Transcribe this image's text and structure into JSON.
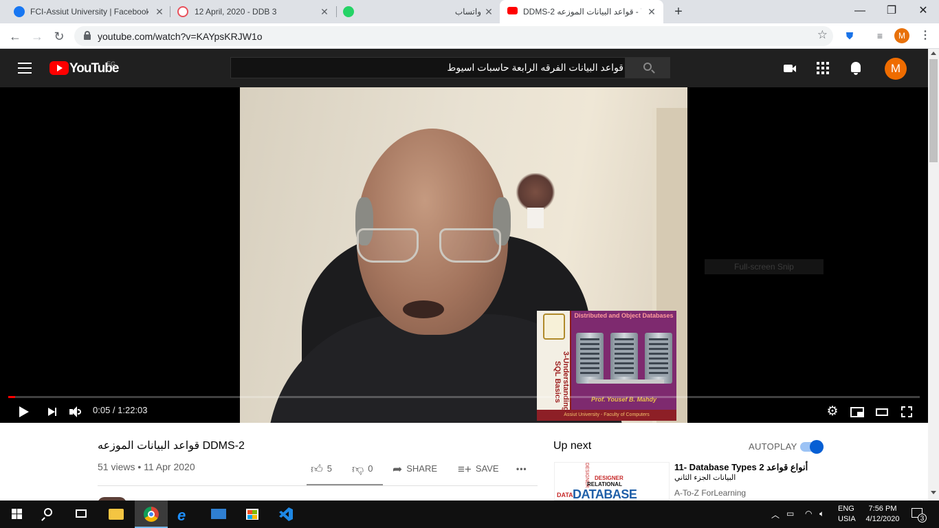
{
  "browser": {
    "tabs": [
      {
        "label": "FCI-Assiut University | Facebook",
        "icon": "facebook-icon",
        "color": "#1877f2"
      },
      {
        "label": "12 April, 2020 - DDB 3",
        "icon": "spiral-icon",
        "color": "#e8505b"
      },
      {
        "label": "واتساب",
        "icon": "whatsapp-icon",
        "color": "#25d366"
      },
      {
        "label": "DDMS-2 قواعد البيانات الموزعه - Y",
        "icon": "youtube-icon",
        "color": "#ff0000",
        "active": true
      }
    ],
    "url": "youtube.com/watch?v=KAYpsKRJW1o",
    "profile_initial": "M"
  },
  "youtube": {
    "logo_text": "YouTube",
    "country_code": "EG",
    "search_query": "قواعد البيانات الفرقه الرابعة حاسبات اسيوط",
    "avatar_initial": "M",
    "brand_color": "#ff0000"
  },
  "player": {
    "time": "0:05 / 1:22:03",
    "progress": 0.001,
    "overlay_tip": "Full-screen Snip",
    "slide": {
      "title": "Distributed and Object Databases",
      "vertical_text": "3-Understanding SQL Basics",
      "author": "Prof. Yousef B. Mahdy",
      "footer": "Assiut University - Faculty of Computers"
    }
  },
  "video": {
    "title": "قواعد البيانات الموزعه DDMS-2",
    "meta": "51 views • 11 Apr 2020",
    "likes": "5",
    "dislikes": "0",
    "share_label": "SHARE",
    "save_label": "SAVE",
    "more_label": "•••"
  },
  "sidebar": {
    "upnext_label": "Up next",
    "autoplay_label": "AUTOPLAY",
    "autoplay_on": true,
    "recommendation": {
      "title": "11- Database Types 2 أنواع قواعد",
      "title_line2": "البيانات الجزء الثاني",
      "channel": "A-To-Z ForLearning",
      "thumb_big": "DATABASE",
      "thumb_mid": "RELATIONAL",
      "thumb_mid2": "DESIGNER",
      "thumb_small": "DATA"
    }
  },
  "taskbar": {
    "lang_line1": "ENG",
    "lang_line2": "USIA",
    "time": "7:56 PM",
    "date": "4/12/2020",
    "notification_count": "3"
  }
}
